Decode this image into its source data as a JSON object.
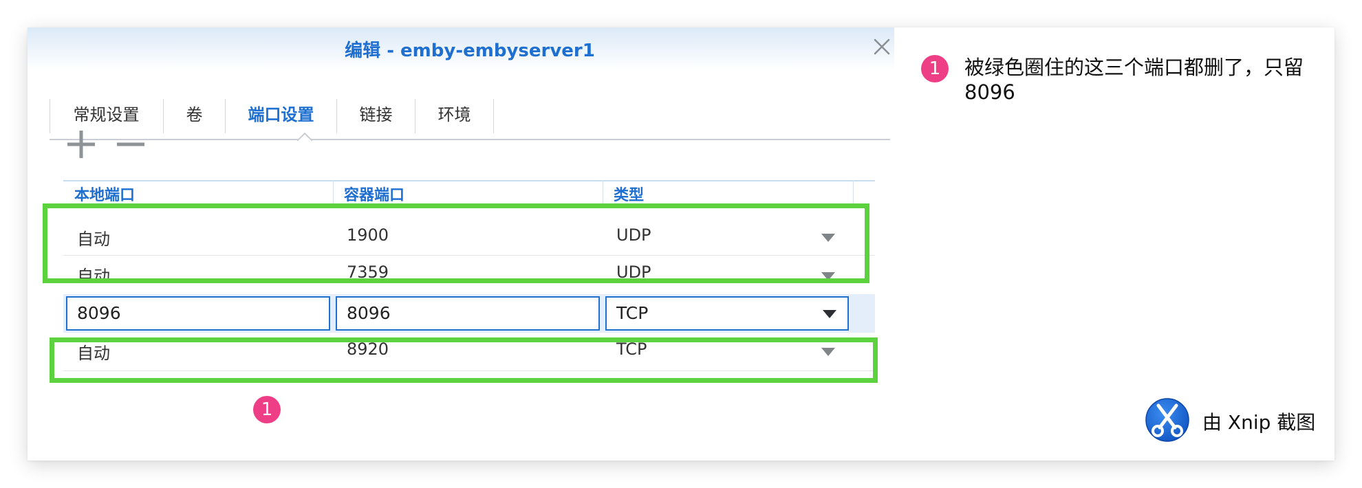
{
  "dialog": {
    "title": "编辑 - emby-embyserver1",
    "tabs": [
      {
        "label": "常规设置"
      },
      {
        "label": "卷"
      },
      {
        "label": "端口设置"
      },
      {
        "label": "链接"
      },
      {
        "label": "环境"
      }
    ],
    "active_tab": "端口设置"
  },
  "toolbar": {
    "add_icon": "plus-icon",
    "remove_icon": "minus-icon"
  },
  "table": {
    "columns": [
      "本地端口",
      "容器端口",
      "类型"
    ],
    "rows": [
      {
        "local": "自动",
        "container": "1900",
        "type": "UDP"
      },
      {
        "local": "自动",
        "container": "7359",
        "type": "UDP"
      },
      {
        "local": "8096",
        "container": "8096",
        "type": "TCP"
      },
      {
        "local": "自动",
        "container": "8920",
        "type": "TCP"
      }
    ]
  },
  "annotation": {
    "badge": "1",
    "note": "被绿色圈住的这三个端口都删了，只留8096"
  },
  "watermark": {
    "label": "由 Xnip 截图"
  },
  "colors": {
    "accent": "#1e6fd0",
    "highlight_green": "#5dd23f",
    "badge_pink": "#ee3f86",
    "selected_row": "#e4eefa"
  }
}
